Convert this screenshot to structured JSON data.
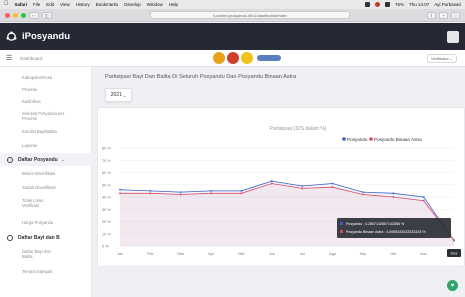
{
  "menubar": {
    "items": [
      "Safari",
      "File",
      "Edit",
      "View",
      "History",
      "Bookmarks",
      "Develop",
      "Window",
      "Help"
    ],
    "right_text": [
      "76%",
      "Thu 14.07",
      "Ayi Purbasari"
    ]
  },
  "browser": {
    "url": "4.admin.ipospandu.id/v1/dashboard/index"
  },
  "app": {
    "name": "iPosyandu"
  },
  "subheader": {
    "breadcrumb": "Dashboard",
    "user_label": "Verifikator"
  },
  "sidebar": {
    "top_items": [
      "Kabupaten/Kota",
      "Provinsi",
      "Kadin/Kec",
      "Sekolah Posyandu per Provinsi",
      "Kondisi Bayi/Balita",
      "Laporan"
    ],
    "section1": "Daftar Posyandu",
    "section1_items": [
      "Belum Diverifikasi",
      "Sudah Diverifikasi",
      "Tidak Lolos Verifikasi",
      "Harga Posyandu"
    ],
    "section2": "Daftar Bayi dan B",
    "section2_items": [
      "Daftar Bayi dan Balita",
      "Tempat Sampah"
    ]
  },
  "main": {
    "title": "Partisipasi Bayi Dan Balita Di Seluruh Posyandu Dan Posyandu Binaan Astra",
    "year_button": "2021"
  },
  "chart_data": {
    "type": "line",
    "title": "Partisipasi (D/S dalam %)",
    "categories": [
      "Jan",
      "Feb",
      "Mar",
      "Apr",
      "Mei",
      "Jun",
      "Jul",
      "Agu",
      "Sep",
      "Okt",
      "Nov",
      "Des"
    ],
    "ylim": [
      0,
      80
    ],
    "y_ticks": [
      "80 %",
      "70 %",
      "60 %",
      "50 %",
      "40 %",
      "30 %",
      "20 %",
      "10 %",
      "0 %"
    ],
    "legend_position": "top-right",
    "series": [
      {
        "name": "Posyandu",
        "color": "#3a5fc8",
        "values": [
          46,
          45,
          44,
          45,
          45,
          53,
          49,
          51,
          44,
          43,
          40,
          4.3
        ]
      },
      {
        "name": "Posyandu Binaan Astra",
        "color": "#d94b63",
        "values": [
          43,
          43,
          42,
          43,
          43,
          51,
          47,
          48,
          42,
          40,
          37,
          4.9
        ]
      }
    ],
    "tooltip": {
      "category": "Des",
      "lines": [
        "Posyandu : 4.2857142857142856 %",
        "Posyandu Binaan Astra : 4.8958333333333333 %"
      ]
    }
  }
}
